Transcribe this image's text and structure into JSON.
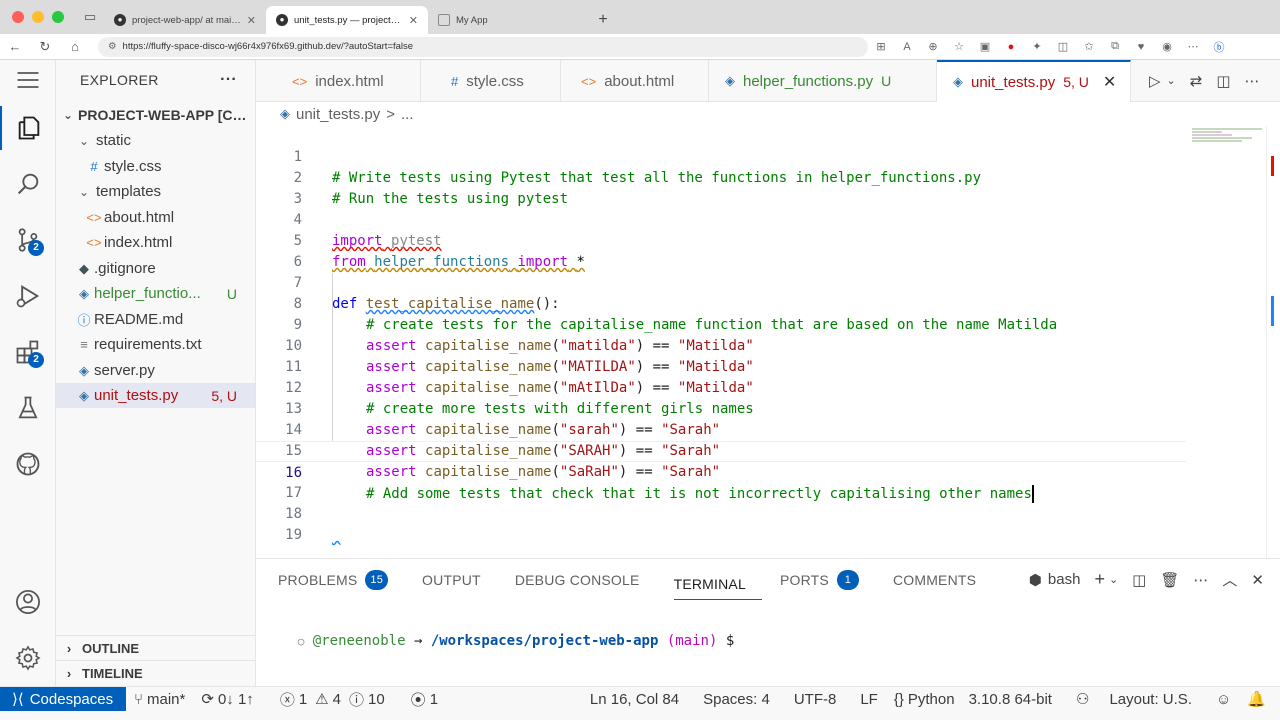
{
  "browser": {
    "tabs": [
      {
        "title": "project-web-app/ at main · rene",
        "active": false
      },
      {
        "title": "unit_tests.py — project-web-a",
        "active": true
      },
      {
        "title": "My App",
        "active": false
      }
    ],
    "url": "https://fluffy-space-disco-wj66r4x976fx69.github.dev/?autoStart=false"
  },
  "activity": {
    "scm_badge": "2",
    "extensions_badge": "2"
  },
  "explorer": {
    "title": "EXPLORER",
    "more": "···",
    "root": "PROJECT-WEB-APP [CO...",
    "items": [
      {
        "label": "static",
        "type": "folder"
      },
      {
        "label": "style.css",
        "type": "css"
      },
      {
        "label": "templates",
        "type": "folder"
      },
      {
        "label": "about.html",
        "type": "html"
      },
      {
        "label": "index.html",
        "type": "html"
      },
      {
        "label": ".gitignore",
        "type": "git"
      },
      {
        "label": "helper_functio...",
        "type": "py",
        "status": "U"
      },
      {
        "label": "README.md",
        "type": "md"
      },
      {
        "label": "requirements.txt",
        "type": "txt"
      },
      {
        "label": "server.py",
        "type": "py"
      },
      {
        "label": "unit_tests.py",
        "type": "py",
        "status": "5, U"
      }
    ],
    "outline": "OUTLINE",
    "timeline": "TIMELINE"
  },
  "editor_tabs": [
    {
      "label": "index.html",
      "icon": "<>"
    },
    {
      "label": "style.css",
      "icon": "#"
    },
    {
      "label": "about.html",
      "icon": "<>"
    },
    {
      "label": "helper_functions.py",
      "icon": "py",
      "status": "U"
    },
    {
      "label": "unit_tests.py",
      "icon": "py",
      "status": "5, U",
      "active": true
    }
  ],
  "breadcrumb": {
    "file": "unit_tests.py",
    "sep": ">",
    "rest": "..."
  },
  "code": {
    "l1": "# Write tests using Pytest that test all the functions in helper_functions.py",
    "l2": "# Run the tests using pytest",
    "l4_kw": "import",
    "l4_mod": "pytest",
    "l5_kw1": "from",
    "l5_mod": "helper_functions",
    "l5_kw2": "import",
    "l5_star": "*",
    "l7_kw": "def",
    "l7_fn": "test_capitalise_name",
    "l7_tail": "():",
    "l8": "# create tests for the capitalise_name function that are based on the name Matilda",
    "assert_kw": "assert",
    "fn_call": "capitalise_name",
    "a9_arg": "\"matilda\"",
    "a10_arg": "\"MATILDA\"",
    "a11_arg": "\"mAtIlDa\"",
    "a_matilda": "\"Matilda\"",
    "l12": "# create more tests with different girls names",
    "a13_arg": "\"sarah\"",
    "a14_arg": "\"SARAH\"",
    "a15_arg": "\"SaRaH\"",
    "a_sarah": "\"Sarah\"",
    "l16": "# Add some tests that check that it is not incorrectly capitalising other names"
  },
  "panel": {
    "tabs": {
      "problems": "PROBLEMS",
      "problems_count": "15",
      "output": "OUTPUT",
      "debug": "DEBUG CONSOLE",
      "terminal": "TERMINAL",
      "ports": "PORTS",
      "ports_count": "1",
      "comments": "COMMENTS"
    },
    "shell": "bash",
    "prompt_user": "@reneenoble",
    "prompt_arrow": "→",
    "prompt_path": "/workspaces/project-web-app",
    "prompt_branch": "(main)",
    "prompt_symbol": "$"
  },
  "status": {
    "remote": "Codespaces",
    "branch": "main*",
    "sync": "0↓ 1↑",
    "errors": "1",
    "warnings": "4",
    "infos": "10",
    "ports": "1",
    "position": "Ln 16, Col 84",
    "spaces": "Spaces: 4",
    "encoding": "UTF-8",
    "eol": "LF",
    "language": "Python",
    "interpreter": "3.10.8 64-bit",
    "layout": "Layout: U.S."
  },
  "colors": {
    "accent": "#005fb8",
    "error": "#b01011",
    "modified": "#388a34"
  }
}
